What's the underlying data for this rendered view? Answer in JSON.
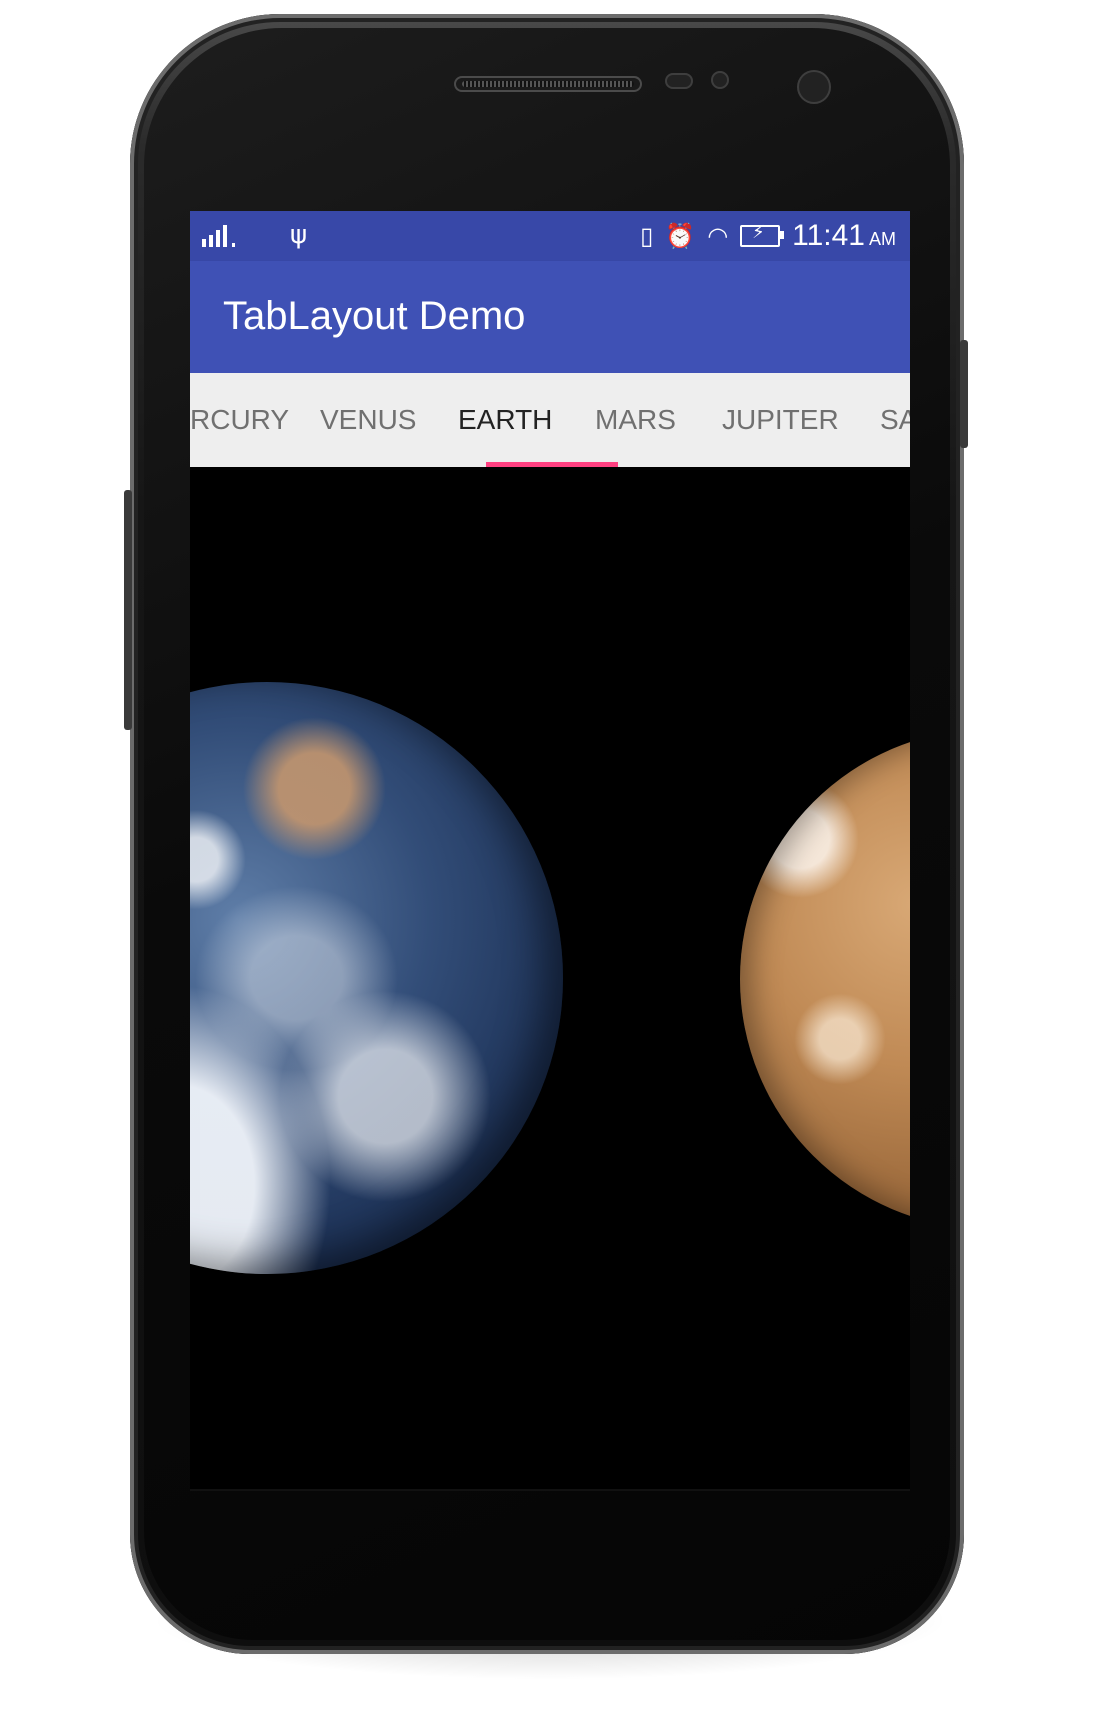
{
  "status_bar": {
    "time": "11:41",
    "ampm": "AM",
    "icons": [
      "signal-icon",
      "usb-icon",
      "vibrate-icon",
      "alarm-icon",
      "wifi-icon",
      "battery-charging-icon"
    ]
  },
  "app_bar": {
    "title": "TabLayout Demo",
    "color": "#3f51b5"
  },
  "tabs": [
    {
      "label": "RCURY"
    },
    {
      "label": "VENUS"
    },
    {
      "label": "EARTH"
    },
    {
      "label": "MARS"
    },
    {
      "label": "JUPITER"
    },
    {
      "label": "SA"
    }
  ],
  "selected_tab": "EARTH",
  "indicator_color": "#ff4081",
  "content": {
    "visible_planets": [
      "earth",
      "mars"
    ]
  }
}
